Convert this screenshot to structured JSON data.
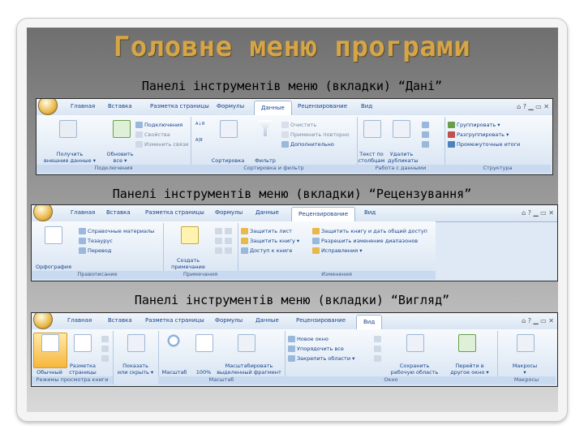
{
  "title": "Головне меню програми",
  "captions": {
    "data": "Панелі інструментів меню (вкладки) “Дані”",
    "review": "Панелі інструментів меню (вкладки) “Рецензування”",
    "view": "Панелі інструментів меню (вкладки) “Вигляд”"
  },
  "window_icons": "⌂ ? ▁ ▭ ✕",
  "ribbon_data": {
    "tabs": [
      "Главная",
      "Вставка",
      "Разметка страницы",
      "Формулы",
      "Данные",
      "Рецензирование",
      "Вид"
    ],
    "groups": {
      "connections": {
        "label": "Подключения",
        "get_external": "Получить\nвнешние данные ▾",
        "refresh_all": "Обновить\nвсе ▾",
        "connections": "Подключения",
        "properties": "Свойства",
        "edit_links": "Изменить связи"
      },
      "sort_filter": {
        "label": "Сортировка и фильтр",
        "az_label": "А↓Я",
        "za_label": "А|Я",
        "sort": "Сортировка",
        "filter": "Фильтр",
        "clear": "Очистить",
        "reapply": "Применить повторно",
        "advanced": "Дополнительно"
      },
      "data_tools": {
        "label": "Работа с данными",
        "text_to_columns": "Текст по\nстолбцам",
        "remove_duplicates": "Удалить\nдубликаты"
      },
      "outline": {
        "label": "Структура",
        "group": "Группировать ▾",
        "ungroup": "Разгруппировать ▾",
        "subtotal": "Промежуточные итоги"
      }
    }
  },
  "ribbon_review": {
    "tabs": [
      "Главная",
      "Вставка",
      "Разметка страницы",
      "Формулы",
      "Данные",
      "Рецензирование",
      "Вид"
    ],
    "groups": {
      "proofing": {
        "label": "Правописание",
        "spelling": "Орфография",
        "research": "Справочные материалы",
        "thesaurus": "Тезаурус",
        "translate": "Перевод"
      },
      "comments": {
        "label": "Примечания",
        "new_comment": "Создать\nпримечание"
      },
      "changes": {
        "label": "Изменения",
        "protect_sheet": "Защитить лист",
        "protect_workbook": "Защитить книгу ▾",
        "share_workbook": "Доступ к книге",
        "protect_share": "Защитить книгу и дать общий доступ",
        "allow_ranges": "Разрешить изменение диапазонов",
        "track_changes": "Исправления ▾"
      }
    }
  },
  "ribbon_view": {
    "tabs": [
      "Главная",
      "Вставка",
      "Разметка страницы",
      "Формулы",
      "Данные",
      "Рецензирование",
      "Вид"
    ],
    "groups": {
      "workbook_views": {
        "label": "Режимы просмотра книги",
        "normal": "Обычный",
        "page_layout": "Разметка\nстраницы"
      },
      "show_hide": {
        "show_hide": "Показать\nили скрыть ▾"
      },
      "zoom": {
        "label": "Масштаб",
        "zoom": "Масштаб",
        "hundred": "100%",
        "zoom_selection": "Масштабировать\nвыделенный фрагмент"
      },
      "window": {
        "label": "Окно",
        "new_window": "Новое окно",
        "arrange_all": "Упорядочить все",
        "freeze_panes": "Закрепить области ▾",
        "save_workspace": "Сохранить\nрабочую область",
        "switch_windows": "Перейти в\nдругое окно ▾"
      },
      "macros": {
        "label": "Макросы",
        "macros": "Макросы\n▾"
      }
    }
  }
}
